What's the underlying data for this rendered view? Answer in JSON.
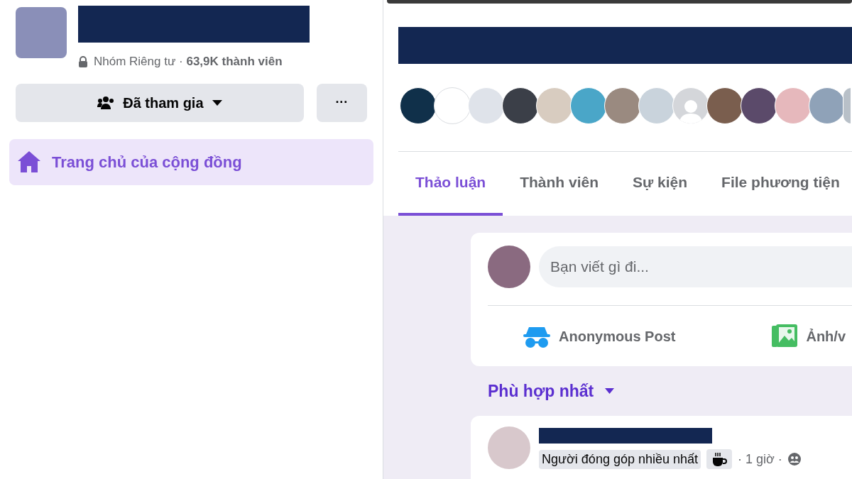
{
  "group": {
    "privacy_members": "Nhóm Riêng tư · **63,9K thành viên**",
    "join_button": "Đã tham gia",
    "more_button": "···"
  },
  "sidebar": {
    "items": [
      {
        "label": "Trang chủ của cộng đồng",
        "selected": true
      }
    ]
  },
  "tabs": [
    {
      "label": "Thảo luận",
      "selected": true
    },
    {
      "label": "Thành viên",
      "selected": false
    },
    {
      "label": "Sự kiện",
      "selected": false
    },
    {
      "label": "File phương tiện",
      "selected": false
    }
  ],
  "composer": {
    "placeholder": "Bạn viết gì đi...",
    "actions": [
      {
        "kind": "anonymous",
        "label": "Anonymous Post"
      },
      {
        "kind": "photo",
        "label": "Ảnh/v"
      }
    ]
  },
  "sort": {
    "label": "Phù hợp nhất"
  },
  "post": {
    "badge": "Người đóng góp nhiều nhất",
    "time": "· 1 giờ ·"
  }
}
